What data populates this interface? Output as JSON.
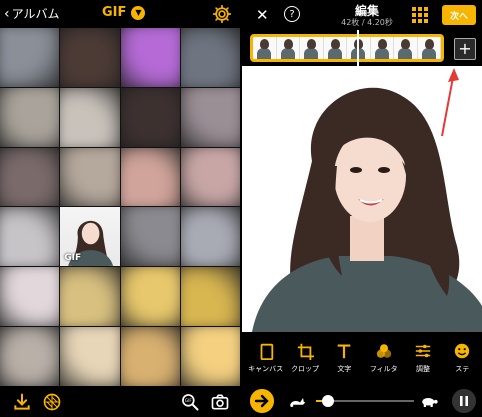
{
  "left_panel": {
    "header": {
      "back_label": "アルバム",
      "title": "GIF",
      "dropdown_icon": "chevron-down-icon",
      "settings_icon": "gear-icon"
    },
    "grid": {
      "selected_badge": "GIF",
      "thumbnails": [
        "#8a8f98",
        "#4c3a35",
        "#b56ad6",
        "#6e7480",
        "#a9a39b",
        "#c9c2bb",
        "#3d3130",
        "#9b8f96",
        "#7a6a6a",
        "#b5a89c",
        "#d0a49a",
        "#c8a6a6",
        "#c7c4c8",
        "selected",
        "#8a8a90",
        "#a8aab4",
        "#e2d8dc",
        "#d8c080",
        "#e8c86c",
        "#d8b650",
        "#b9b0a8",
        "#e8d6b8",
        "#d8b070",
        "#f4d080"
      ]
    },
    "toolbar": {
      "icons": [
        "download-icon",
        "grid-pattern-icon",
        "gif-search-icon",
        "camera-icon"
      ]
    }
  },
  "right_panel": {
    "header": {
      "title": "編集",
      "subtitle": "42枚 / 4.20秒",
      "close_icon": "close-icon",
      "help_icon": "help-icon",
      "grid_icon": "grid-icon",
      "next_label": "次へ"
    },
    "timeline": {
      "frame_count_visible": 8,
      "playhead_fraction": 0.55,
      "add_label": "+"
    },
    "tools": [
      {
        "label": "キャンバス",
        "icon": "canvas-icon"
      },
      {
        "label": "クロップ",
        "icon": "crop-icon"
      },
      {
        "label": "文字",
        "icon": "text-icon"
      },
      {
        "label": "フィルタ",
        "icon": "filter-icon"
      },
      {
        "label": "調整",
        "icon": "adjust-icon"
      },
      {
        "label": "ステ",
        "icon": "sticker-icon"
      }
    ],
    "playback": {
      "speed_fraction": 0.12,
      "play_icon": "play-icon",
      "fast_icon": "rabbit-icon",
      "slow_icon": "turtle-icon",
      "pause_icon": "pause-icon"
    }
  },
  "colors": {
    "accent": "#f7b500",
    "background": "#000000",
    "arrow": "#e53935"
  }
}
